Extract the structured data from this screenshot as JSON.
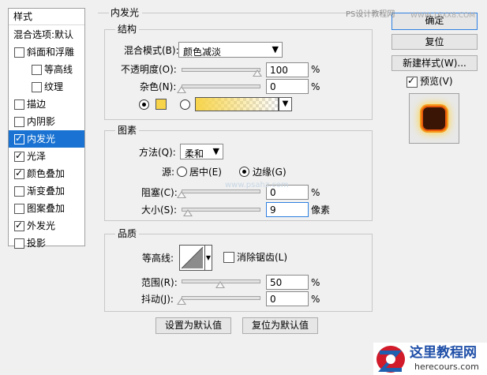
{
  "sidebar": {
    "header": "样式",
    "items": [
      {
        "label": "混合选项:默认",
        "checkbox": false,
        "checked": false
      },
      {
        "label": "斜面和浮雕",
        "checkbox": true,
        "checked": false
      },
      {
        "label": "等高线",
        "checkbox": true,
        "checked": false
      },
      {
        "label": "纹理",
        "checkbox": true,
        "checked": false
      },
      {
        "label": "描边",
        "checkbox": true,
        "checked": false
      },
      {
        "label": "内阴影",
        "checkbox": true,
        "checked": false
      },
      {
        "label": "内发光",
        "checkbox": true,
        "checked": true
      },
      {
        "label": "光泽",
        "checkbox": true,
        "checked": true
      },
      {
        "label": "颜色叠加",
        "checkbox": true,
        "checked": true
      },
      {
        "label": "渐变叠加",
        "checkbox": true,
        "checked": false
      },
      {
        "label": "图案叠加",
        "checkbox": true,
        "checked": false
      },
      {
        "label": "外发光",
        "checkbox": true,
        "checked": true
      },
      {
        "label": "投影",
        "checkbox": true,
        "checked": false
      }
    ]
  },
  "main": {
    "title": "内发光",
    "structure": {
      "title": "结构",
      "blend_mode_label": "混合模式(B):",
      "blend_mode_value": "颜色减淡",
      "opacity_label": "不透明度(O):",
      "opacity_value": "100",
      "noise_label": "杂色(N):",
      "noise_value": "0",
      "percent": "%",
      "glow_color": "#f7d44a"
    },
    "elements": {
      "title": "图素",
      "method_label": "方法(Q):",
      "method_value": "柔和",
      "source_label": "源:",
      "source_center": "居中(E)",
      "source_edge": "边缘(G)",
      "choke_label": "阻塞(C):",
      "choke_value": "0",
      "size_label": "大小(S):",
      "size_value": "9",
      "size_unit": "像素",
      "percent": "%"
    },
    "quality": {
      "title": "品质",
      "contour_label": "等高线:",
      "antialias_label": "消除锯齿(L)",
      "range_label": "范围(R):",
      "range_value": "50",
      "jitter_label": "抖动(J):",
      "jitter_value": "0",
      "percent": "%"
    },
    "set_default": "设置为默认值",
    "reset_default": "复位为默认值"
  },
  "right": {
    "ok": "确定",
    "reset": "复位",
    "new_style": "新建样式(W)...",
    "preview_label": "预览(V)",
    "preview_checked": true
  },
  "watermark": {
    "top": "PS设计教程网",
    "top_url": "WWW.16XX8.COM",
    "brand": "这里教程网",
    "brand_url": "herecours.com",
    "center": "www.psahz.com"
  }
}
